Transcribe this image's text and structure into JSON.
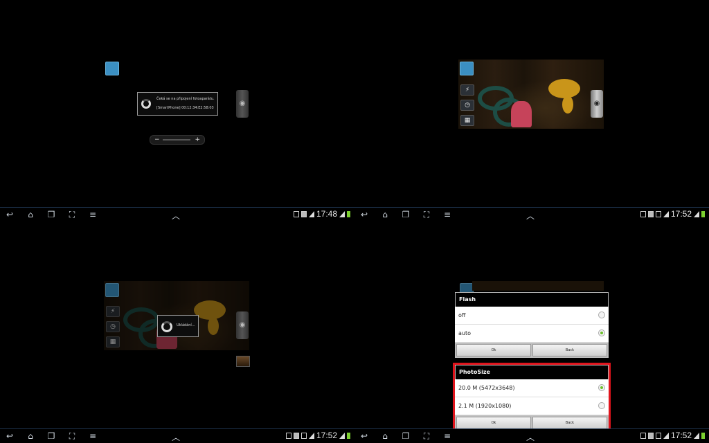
{
  "panels": {
    "connecting": {
      "message_line1": "Čeká se na připojení fotoaparátu.",
      "message_line2": "[SmartPhone] 00:12:34:E2:58:03",
      "zoom_minus": "−",
      "zoom_plus": "+",
      "status_time": "17:48"
    },
    "preview": {
      "status_time": "17:52"
    },
    "saving": {
      "message": "Ukládání...",
      "status_time": "17:52"
    },
    "settings": {
      "status_time": "17:52",
      "flash": {
        "title": "Flash",
        "options": [
          {
            "label": "off",
            "selected": false
          },
          {
            "label": "auto",
            "selected": true
          }
        ],
        "ok_label": "Ok",
        "back_label": "Back"
      },
      "photosize": {
        "title": "PhotoSize",
        "options": [
          {
            "label": "20.0 M (5472x3648)",
            "selected": true
          },
          {
            "label": "2.1 M (1920x1080)",
            "selected": false
          }
        ],
        "ok_label": "Ok",
        "back_label": "Back"
      }
    }
  },
  "navbar": {
    "back_icon": "back-icon",
    "home_icon": "home-icon",
    "recents_icon": "recent-apps-icon",
    "screenshot_icon": "screenshot-icon",
    "menu_icon": "menu-icon",
    "up_icon": "chevron-up-icon"
  },
  "colors": {
    "highlight": "#e0141c",
    "radio_on": "#6bbf2a",
    "accent": "#3b8fc2"
  }
}
